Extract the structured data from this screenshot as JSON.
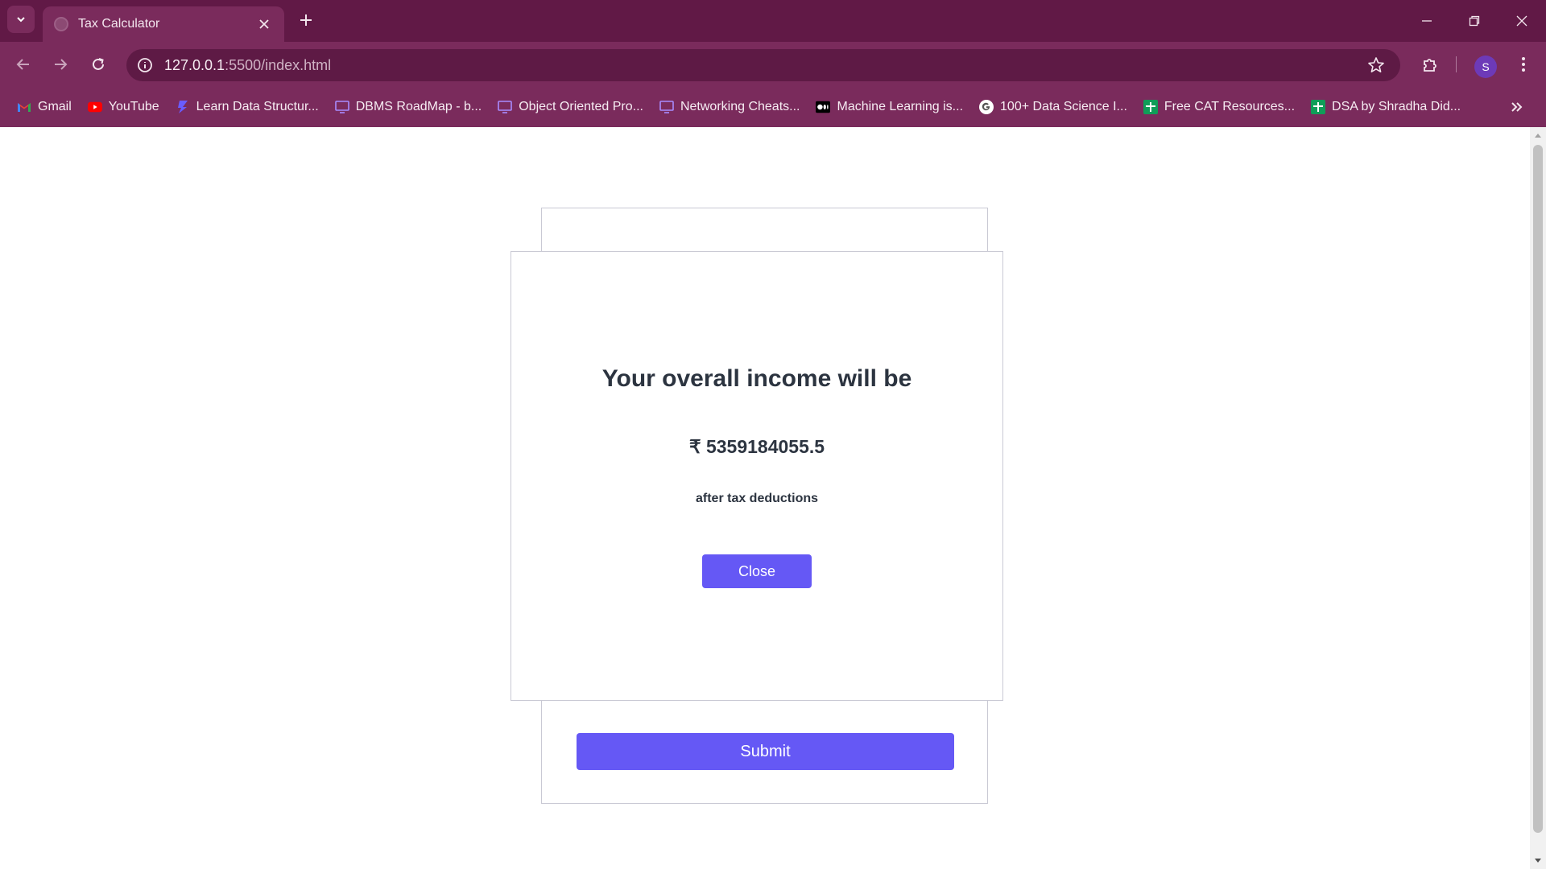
{
  "browser": {
    "tab": {
      "title": "Tax Calculator"
    },
    "address": {
      "host": "127.0.0.1",
      "path": ":5500/index.html"
    },
    "profile_initial": "S",
    "bookmarks": [
      {
        "label": "Gmail",
        "icon": "gmail-icon"
      },
      {
        "label": "YouTube",
        "icon": "youtube-icon"
      },
      {
        "label": "Learn Data Structur...",
        "icon": "arrow-logo-icon"
      },
      {
        "label": "DBMS RoadMap - b...",
        "icon": "monitor-icon"
      },
      {
        "label": "Object Oriented Pro...",
        "icon": "monitor-icon"
      },
      {
        "label": "Networking Cheats...",
        "icon": "monitor-icon"
      },
      {
        "label": "Machine Learning is...",
        "icon": "medium-icon"
      },
      {
        "label": "100+ Data Science I...",
        "icon": "google-icon"
      },
      {
        "label": "Free CAT Resources...",
        "icon": "sheets-icon"
      },
      {
        "label": "DSA by Shradha Did...",
        "icon": "sheets-icon"
      }
    ]
  },
  "page": {
    "submit_label": "Submit",
    "modal": {
      "title": "Your overall income will be",
      "amount": "₹ 5359184055.5",
      "subtitle": "after tax deductions",
      "close_label": "Close"
    }
  },
  "colors": {
    "tabstrip": "#611946",
    "toolbar": "#7a2b5c",
    "accent": "#6558f5",
    "text_dark": "#2c3440"
  }
}
